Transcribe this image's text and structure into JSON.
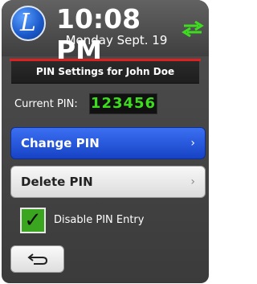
{
  "header": {
    "logo_letter": "L",
    "time": "10:08 PM",
    "date": "Monday Sept. 19",
    "sync_icon": "sync-arrows-icon",
    "accent_color": "#e02020"
  },
  "screen": {
    "title": "PIN Settings for John Doe",
    "current_pin_label": "Current PIN:",
    "current_pin_value": "123456"
  },
  "actions": {
    "change_pin_label": "Change PIN",
    "delete_pin_label": "Delete PIN",
    "chevron": "›"
  },
  "options": {
    "disable_pin_entry_label": "Disable PIN Entry",
    "disable_pin_entry_checked": true,
    "check_mark": "✓"
  },
  "footer": {
    "back_icon": "back-arrow-icon"
  },
  "colors": {
    "primary_button": "#1f4fd8",
    "pin_text": "#3edc1f",
    "checkbox_fill": "#3aa51e"
  }
}
